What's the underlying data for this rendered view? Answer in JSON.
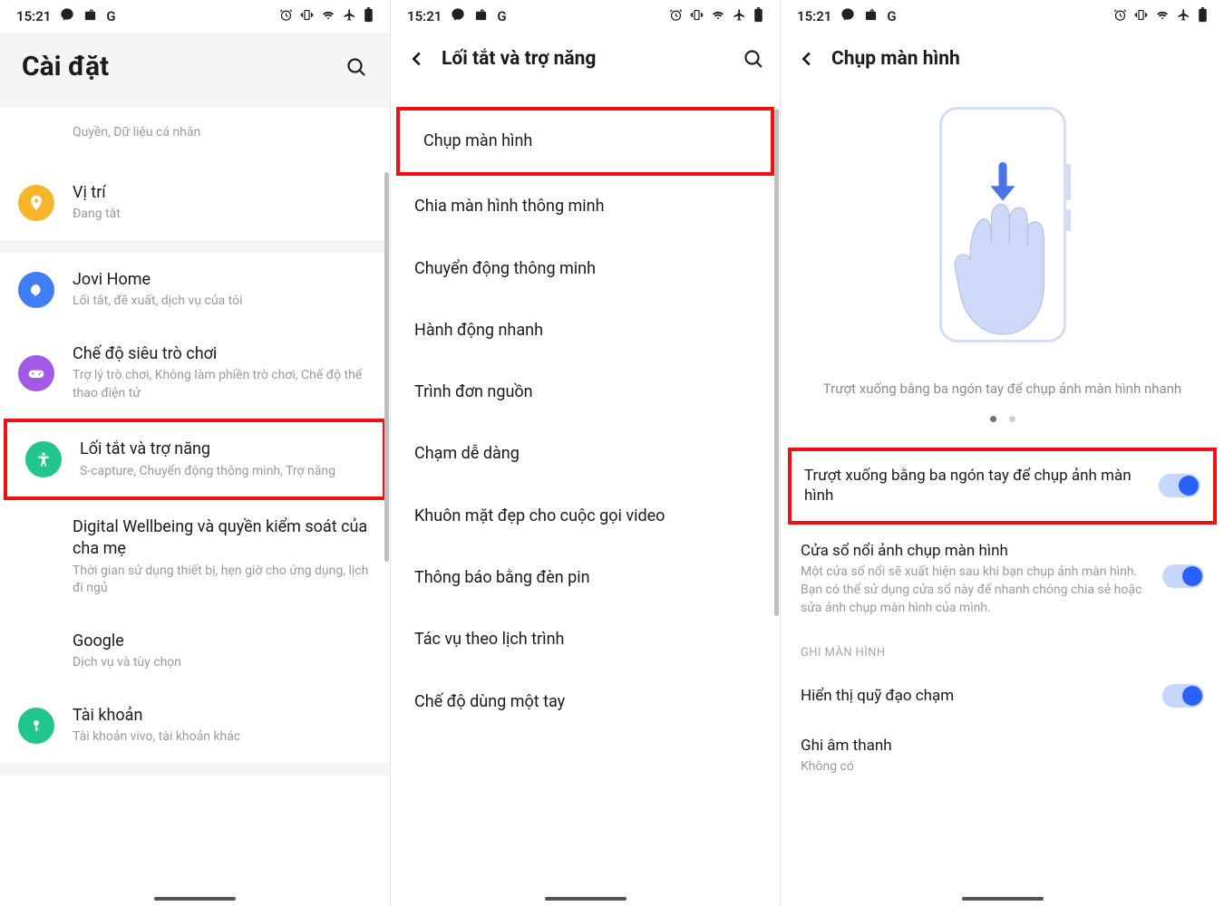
{
  "status": {
    "time": "15:21"
  },
  "pane1": {
    "title": "Cài đặt",
    "truncated_top": "Quyền, Dữ liệu cá nhân",
    "items": [
      {
        "title": "Vị trí",
        "sub": "Đang tắt",
        "icon": "location",
        "color": "#f7b52c"
      },
      {
        "title": "Jovi Home",
        "sub": "Lối tắt, đề xuất, dịch vụ của tôi",
        "icon": "jovi",
        "color": "#3f7df4"
      },
      {
        "title": "Chế độ siêu trò chơi",
        "sub": "Trợ lý trò chơi, Không làm phiền trò chơi, Chế độ thể thao điện tử",
        "icon": "game",
        "color": "#a259e6"
      },
      {
        "title": "Lối tắt và trợ năng",
        "sub": "S-capture, Chuyển động thông minh, Trợ năng",
        "icon": "accessibility",
        "color": "#22c58b",
        "hl": true
      },
      {
        "title": "Digital Wellbeing và quyền kiểm soát của cha mẹ",
        "sub": "Thời gian sử dụng thiết bị, hẹn giờ cho ứng dụng, lịch đi ngủ",
        "icon": "none"
      },
      {
        "title": "Google",
        "sub": "Dịch vụ và tùy chọn",
        "icon": "none"
      },
      {
        "title": "Tài khoản",
        "sub": "Tài khoản vivo, tài khoản khác",
        "icon": "key",
        "color": "#22c58b"
      }
    ]
  },
  "pane2": {
    "title": "Lối tắt và trợ năng",
    "items": [
      {
        "title": "Chụp màn hình",
        "hl": true
      },
      {
        "title": "Chia màn hình thông minh"
      },
      {
        "title": "Chuyển động thông minh"
      },
      {
        "title": "Hành động nhanh"
      },
      {
        "title": "Trình đơn nguồn"
      },
      {
        "title": "Chạm dễ dàng"
      },
      {
        "title": "Khuôn mặt đẹp cho cuộc gọi video"
      },
      {
        "title": "Thông báo bằng đèn pin"
      },
      {
        "title": "Tác vụ theo lịch trình"
      },
      {
        "title": "Chế độ dùng một tay"
      }
    ]
  },
  "pane3": {
    "title": "Chụp màn hình",
    "illus_caption": "Trượt xuống bằng ba ngón tay để chụp ảnh màn hình nhanh",
    "rows": [
      {
        "title": "Trượt xuống bằng ba ngón tay để chụp ảnh màn hình",
        "toggle": true,
        "hl": true
      },
      {
        "title": "Cửa sổ nổi ảnh chụp màn hình",
        "sub": "Một cửa sổ nổi sẽ xuất hiện sau khi bạn chụp ảnh màn hình. Bạn có thể sử dụng cửa sổ này để nhanh chóng chia sẻ hoặc sửa ảnh chụp màn hình của mình.",
        "toggle": true
      }
    ],
    "section_label": "GHI MÀN HÌNH",
    "rows2": [
      {
        "title": "Hiển thị quỹ đạo chạm",
        "toggle": true
      },
      {
        "title": "Ghi âm thanh",
        "sub": "Không có"
      }
    ]
  }
}
